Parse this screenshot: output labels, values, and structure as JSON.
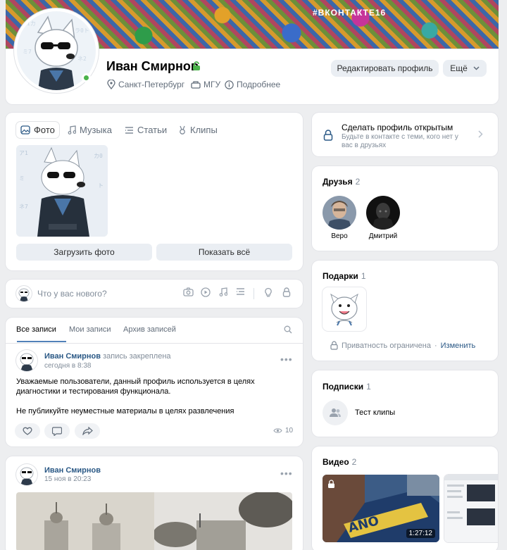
{
  "header": {
    "hashtag": "#ВКОНТАКТЕ16",
    "name": "Иван Смирнов",
    "city": "Санкт-Петербург",
    "university": "МГУ",
    "more_info": "Подробнее",
    "edit_button": "Редактировать профиль",
    "more_button": "Ещё"
  },
  "media_tabs": [
    {
      "label": "Фото",
      "icon": "photo-icon",
      "active": true
    },
    {
      "label": "Музыка",
      "icon": "music-note-icon",
      "active": false
    },
    {
      "label": "Статьи",
      "icon": "article-icon",
      "active": false
    },
    {
      "label": "Клипы",
      "icon": "clips-icon",
      "active": false
    }
  ],
  "photos": {
    "upload_button": "Загрузить фото",
    "show_all_button": "Показать всё"
  },
  "composer": {
    "placeholder": "Что у вас нового?"
  },
  "wall": {
    "tabs": [
      "Все записи",
      "Мои записи",
      "Архив записей"
    ]
  },
  "posts": [
    {
      "author": "Иван Смирнов",
      "pinned_note": "запись закреплена",
      "date": "сегодня в 8:38",
      "text_1": "Уважаемые пользователи, данный профиль используется в целях диагностики и тестирования функционала.",
      "text_2": "Не публикуйте неуместные материалы в целях развлечения",
      "views": "10"
    },
    {
      "author": "Иван Смирнов",
      "date": "15 ноя в 20:23"
    }
  ],
  "sidebar": {
    "open_profile_title": "Сделать профиль открытым",
    "open_profile_desc": "Будьте в контакте с теми, кого нет у вас в друзьях",
    "friends_title": "Друзья",
    "friends_count": "2",
    "friends": [
      "Веро",
      "Дмитрий"
    ],
    "gifts_title": "Подарки",
    "gifts_count": "1",
    "privacy_text": "Приватность ограничена",
    "privacy_sep": "·",
    "privacy_link": "Изменить",
    "subs_title": "Подписки",
    "subs_count": "1",
    "subs_item": "Тест клипы",
    "video_title": "Видео",
    "video_count": "2",
    "video_duration": "1:27:12"
  },
  "colors": {
    "accent": "#2a5885",
    "online": "#4bb34b",
    "background": "#edeef0"
  }
}
